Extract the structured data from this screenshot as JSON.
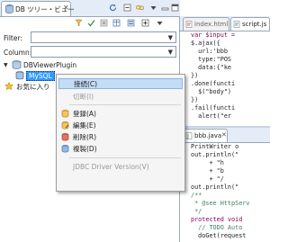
{
  "left_view": {
    "tab_title": "DB ツリー・ビュー",
    "filter_label": "Filter:",
    "column_label": "Column:",
    "tree": {
      "root": "DBViewerPlugin",
      "selected_child": "MySQL",
      "favorites": "お気に入り"
    }
  },
  "context_menu": {
    "items": [
      {
        "label": "接続(C)",
        "enabled": true,
        "highlighted": true,
        "icon": "connect-icon"
      },
      {
        "label": "切断(I)",
        "enabled": false,
        "icon": ""
      },
      {
        "label": "登録(A)",
        "enabled": true,
        "icon": "register-icon"
      },
      {
        "label": "編集(E)",
        "enabled": true,
        "icon": "edit-icon"
      },
      {
        "label": "削除(R)",
        "enabled": true,
        "icon": "delete-icon"
      },
      {
        "label": "複製(D)",
        "enabled": true,
        "icon": "duplicate-icon"
      },
      {
        "label": "JDBC Driver Version(V)",
        "enabled": false,
        "icon": ""
      }
    ]
  },
  "editor_top": {
    "tabs": [
      "index.html",
      "script.js"
    ],
    "code": [
      "",
      "var $input =",
      "",
      "$.ajax({",
      "  url:'bbb",
      "  type:\"POS",
      "  data:{\"ke",
      "})",
      ".done(functi",
      "  $(\"body\")",
      "})",
      ".fail(functi",
      "  alert(\"er"
    ]
  },
  "editor_bottom": {
    "tab": "bbb.java",
    "code": [
      "PrintWriter o",
      "out.println(\"",
      "     + \"h",
      "     + \"b",
      "     + \"/",
      "out.println(\"",
      "",
      "",
      "/**",
      " * @see HttpServ",
      " */",
      "protected void",
      "  // TODO Auto",
      "  doGet(request"
    ]
  },
  "colors": {
    "selection": "#3399ff",
    "menu_highlight": "#c5dcf5",
    "keyword": "#7f0055",
    "comment": "#3f7f5f",
    "string": "#2a00ff"
  }
}
